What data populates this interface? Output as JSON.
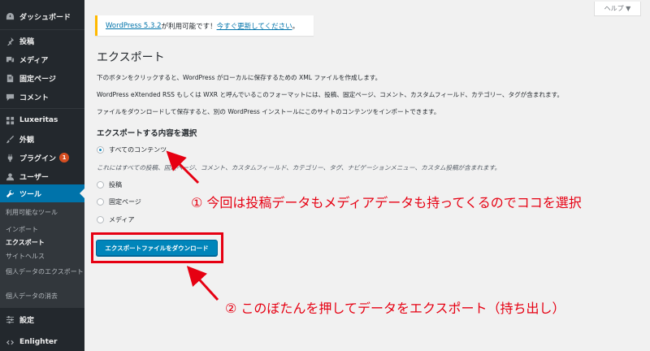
{
  "sidebar": {
    "items": [
      {
        "label": "ダッシュボード",
        "icon": "dashboard-icon"
      },
      {
        "label": "投稿",
        "icon": "pushpin-icon"
      },
      {
        "label": "メディア",
        "icon": "media-icon"
      },
      {
        "label": "固定ページ",
        "icon": "page-icon"
      },
      {
        "label": "コメント",
        "icon": "comment-icon"
      },
      {
        "label": "Luxeritas",
        "icon": "grid-icon"
      },
      {
        "label": "外観",
        "icon": "brush-icon"
      },
      {
        "label": "プラグイン",
        "icon": "plugin-icon",
        "badge": "1"
      },
      {
        "label": "ユーザー",
        "icon": "user-icon"
      },
      {
        "label": "ツール",
        "icon": "wrench-icon",
        "active": true
      },
      {
        "label": "設定",
        "icon": "settings-icon"
      },
      {
        "label": "Enlighter",
        "icon": "code-icon"
      }
    ],
    "submenu": [
      "利用可能なツール",
      "インポート",
      "エクスポート",
      "サイトヘルス",
      "個人データのエクスポート",
      "個人データの消去"
    ]
  },
  "help_tab": {
    "label": "ヘルプ ▼"
  },
  "notice": {
    "version_link": "WordPress 5.3.2",
    "middle": " が利用可能です！",
    "update_link": "今すぐ更新してください",
    "end": "。"
  },
  "page": {
    "title": "エクスポート",
    "desc1": "下のボタンをクリックすると、WordPress がローカルに保存するための XML ファイルを作成します。",
    "desc2": "WordPress eXtended RSS もしくは WXR と呼んでいるこのフォーマットには、投稿、固定ページ、コメント、カスタムフィールド、カテゴリー、タグが含まれます。",
    "desc3": "ファイルをダウンロードして保存すると、別の WordPress インストールにこのサイトのコンテンツをインポートできます。",
    "section_title": "エクスポートする内容を選択",
    "options": {
      "all": "すべてのコンテンツ",
      "posts": "投稿",
      "pages": "固定ページ",
      "media": "メディア"
    },
    "all_note": "これにはすべての投稿、固定ページ、コメント、カスタムフィールド、カテゴリー、タグ、ナビゲーションメニュー、カスタム投稿が含まれます。",
    "download_button": "エクスポートファイルをダウンロード"
  },
  "annotations": {
    "note1": "① 今回は投稿データもメディアデータも持ってくるのでココを選択",
    "note2": "② このぼたんを押してデータをエクスポート（持ち出し）",
    "color": "#e60012"
  }
}
